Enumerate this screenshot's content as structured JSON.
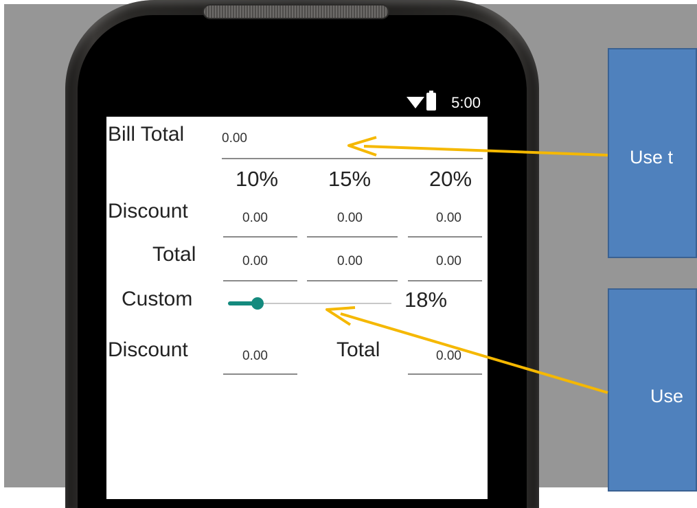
{
  "status": {
    "time": "5:00"
  },
  "bill": {
    "label": "Bill Total",
    "value": "0.00"
  },
  "headers": [
    "10%",
    "15%",
    "20%"
  ],
  "discount_row": {
    "label": "Discount",
    "values": [
      "0.00",
      "0.00",
      "0.00"
    ]
  },
  "total_row": {
    "label": "Total",
    "values": [
      "0.00",
      "0.00",
      "0.00"
    ]
  },
  "custom": {
    "label": "Custom",
    "percent": "18%",
    "slider_value": 0.18
  },
  "custom_result": {
    "discount_label": "Discount",
    "discount_value": "0.00",
    "total_label": "Total",
    "total_value": "0.00"
  },
  "callouts": {
    "top_text": "Use t",
    "bottom_text": "Use"
  },
  "colors": {
    "accent": "#148a7e",
    "callout": "#4f81bd",
    "arrow": "#f5b800"
  }
}
